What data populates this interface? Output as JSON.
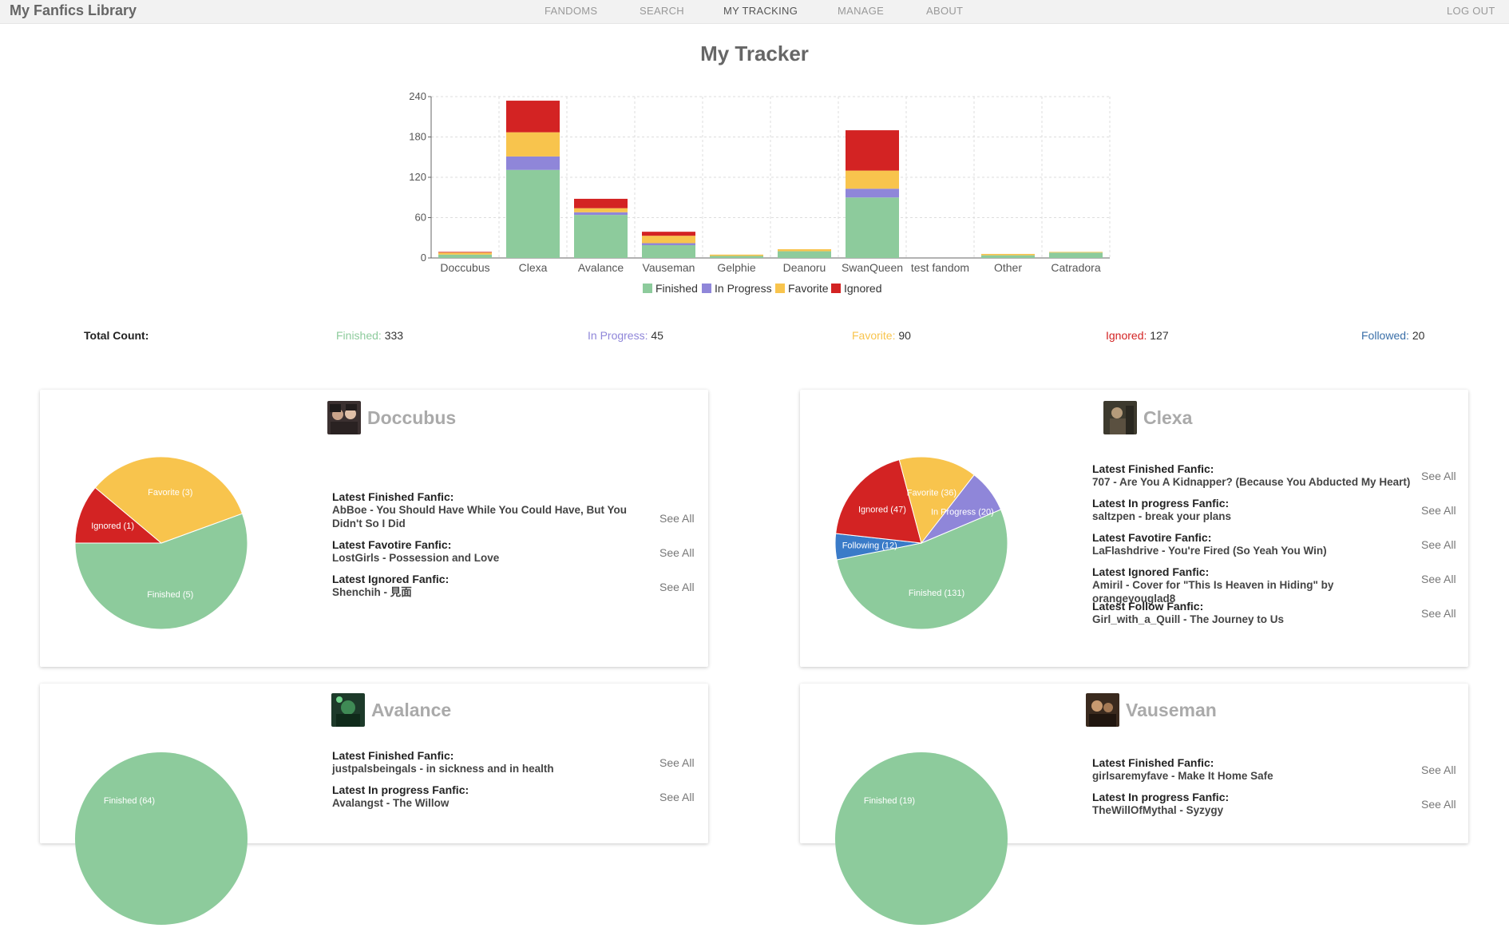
{
  "nav": {
    "brand": "My Fanfics Library",
    "items": [
      "FANDOMS",
      "SEARCH",
      "MY TRACKING",
      "MANAGE",
      "ABOUT"
    ],
    "active": "MY TRACKING",
    "logout": "LOG OUT"
  },
  "page_title": "My Tracker",
  "chart_data": {
    "type": "bar",
    "stacked": true,
    "categories": [
      "Doccubus",
      "Clexa",
      "Avalance",
      "Vauseman",
      "Gelphie",
      "Deanoru",
      "SwanQueen",
      "test fandom",
      "Other",
      "Catradora"
    ],
    "series": [
      {
        "name": "Finished",
        "color": "#8dcb9c",
        "values": [
          5,
          131,
          64,
          19,
          3,
          10,
          90,
          0,
          4,
          8
        ]
      },
      {
        "name": "In Progress",
        "color": "#8f86d9",
        "values": [
          0,
          20,
          4,
          3,
          0,
          0,
          13,
          0,
          0,
          0
        ]
      },
      {
        "name": "Favorite",
        "color": "#f8c44d",
        "values": [
          3,
          36,
          6,
          11,
          2,
          3,
          27,
          0,
          2,
          1
        ]
      },
      {
        "name": "Ignored",
        "color": "#d32323",
        "values": [
          1,
          47,
          14,
          6,
          0,
          0,
          60,
          0,
          0,
          0
        ]
      }
    ],
    "ylim": [
      0,
      240
    ],
    "yticks": [
      0,
      60,
      120,
      180,
      240
    ],
    "grid": true,
    "legend_position": "bottom"
  },
  "totals": {
    "label": "Total Count:",
    "items": [
      {
        "label": "Finished:",
        "value": "333",
        "color": "#8dcb9c"
      },
      {
        "label": "In Progress:",
        "value": "45",
        "color": "#8f86d9"
      },
      {
        "label": "Favorite:",
        "value": "90",
        "color": "#f8c44d"
      },
      {
        "label": "Ignored:",
        "value": "127",
        "color": "#d32323"
      },
      {
        "label": "Followed:",
        "value": "20",
        "color": "#3a6fa8"
      }
    ]
  },
  "see_all": "See All",
  "cards": [
    {
      "name": "Doccubus",
      "pie": [
        {
          "label": "Finished (5)",
          "value": 5,
          "color": "#8dcb9c"
        },
        {
          "label": "Ignored (1)",
          "value": 1,
          "color": "#d32323"
        },
        {
          "label": "Favorite (3)",
          "value": 3,
          "color": "#f8c44d"
        }
      ],
      "latest": [
        {
          "label": "Latest Finished Fanfic:",
          "value": "AbBoe - You Should Have While You Could Have, But You Didn't So I Did"
        },
        {
          "label": "Latest Favotire Fanfic:",
          "value": "LostGirls - Possession and Love"
        },
        {
          "label": "Latest Ignored Fanfic:",
          "value": "Shenchih - 見面"
        }
      ]
    },
    {
      "name": "Clexa",
      "pie": [
        {
          "label": "Finished (131)",
          "value": 131,
          "color": "#8dcb9c"
        },
        {
          "label": "Following (12)",
          "value": 12,
          "color": "#3a7bc8"
        },
        {
          "label": "Ignored (47)",
          "value": 47,
          "color": "#d32323"
        },
        {
          "label": "Favorite (36)",
          "value": 36,
          "color": "#f8c44d"
        },
        {
          "label": "In Progress (20)",
          "value": 20,
          "color": "#8f86d9"
        }
      ],
      "latest": [
        {
          "label": "Latest Finished Fanfic:",
          "value": "707 - Are You A Kidnapper? (Because You Abducted My Heart)"
        },
        {
          "label": "Latest In progress Fanfic:",
          "value": "saltzpen - break your plans"
        },
        {
          "label": "Latest Favotire Fanfic:",
          "value": "LaFlashdrive - You're Fired (So Yeah You Win)"
        },
        {
          "label": "Latest Ignored Fanfic:",
          "value": "Amiril - Cover for \"This Is Heaven in Hiding\" by orangeyouglad8"
        },
        {
          "label": "Latest Follow Fanfic:",
          "value": "Girl_with_a_Quill - The Journey to Us"
        }
      ]
    },
    {
      "name": "Avalance",
      "pie": [
        {
          "label": "Finished (64)",
          "value": 64,
          "color": "#8dcb9c"
        }
      ],
      "latest": [
        {
          "label": "Latest Finished Fanfic:",
          "value": "justpalsbeingals - in sickness and in health"
        },
        {
          "label": "Latest In progress Fanfic:",
          "value": "Avalangst - The Willow"
        }
      ]
    },
    {
      "name": "Vauseman",
      "pie": [
        {
          "label": "Finished (19)",
          "value": 19,
          "color": "#8dcb9c"
        }
      ],
      "latest": [
        {
          "label": "Latest Finished Fanfic:",
          "value": "girlsaremyfave - Make It Home Safe"
        },
        {
          "label": "Latest In progress Fanfic:",
          "value": "TheWillOfMythal - Syzygy"
        }
      ]
    }
  ]
}
